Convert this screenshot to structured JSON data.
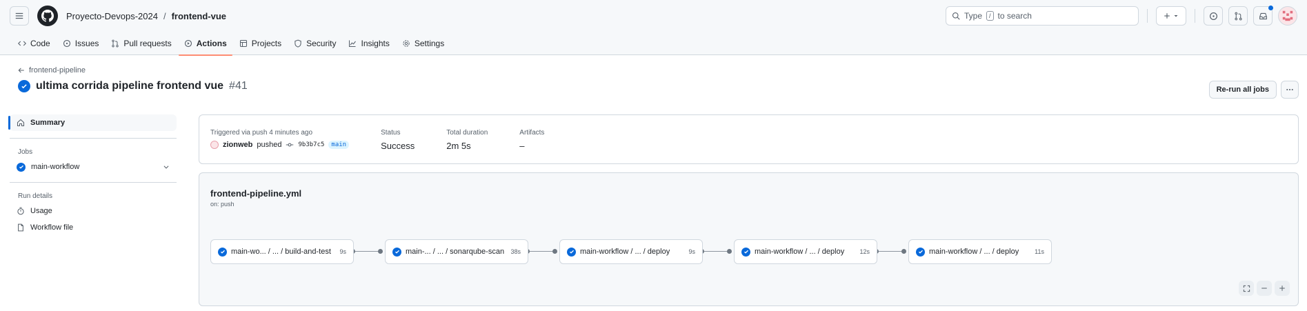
{
  "header": {
    "org": "Proyecto-Devops-2024",
    "separator": "/",
    "repo": "frontend-vue",
    "search_prefix": "Type",
    "search_key": "/",
    "search_suffix": "to search"
  },
  "tabs": [
    {
      "label": "Code"
    },
    {
      "label": "Issues"
    },
    {
      "label": "Pull requests"
    },
    {
      "label": "Actions"
    },
    {
      "label": "Projects"
    },
    {
      "label": "Security"
    },
    {
      "label": "Insights"
    },
    {
      "label": "Settings"
    }
  ],
  "run": {
    "back_label": "frontend-pipeline",
    "title": "ultima corrida pipeline frontend vue",
    "number": "#41",
    "rerun_label": "Re-run all jobs"
  },
  "sidebar": {
    "summary_label": "Summary",
    "jobs_heading": "Jobs",
    "job_label": "main-workflow",
    "run_details_heading": "Run details",
    "usage_label": "Usage",
    "workflow_file_label": "Workflow file"
  },
  "summary": {
    "trigger_label": "Triggered via push 4 minutes ago",
    "actor": "zionweb",
    "action": "pushed",
    "sha": "9b3b7c5",
    "branch": "main",
    "status_label": "Status",
    "status_value": "Success",
    "duration_label": "Total duration",
    "duration_value": "2m 5s",
    "artifacts_label": "Artifacts",
    "artifacts_value": "–"
  },
  "graph": {
    "file": "frontend-pipeline.yml",
    "trigger": "on: push",
    "jobs": [
      {
        "name": "main-wo... / ... / build-and-test",
        "duration": "9s"
      },
      {
        "name": "main-... / ... / sonarqube-scan",
        "duration": "38s"
      },
      {
        "name": "main-workflow / ... / deploy",
        "duration": "9s"
      },
      {
        "name": "main-workflow / ... / deploy",
        "duration": "12s"
      },
      {
        "name": "main-workflow / ... / deploy",
        "duration": "11s"
      }
    ]
  },
  "colors": {
    "accent": "#0969da",
    "tab_underline": "#fd8c73",
    "border": "#d0d7de"
  }
}
